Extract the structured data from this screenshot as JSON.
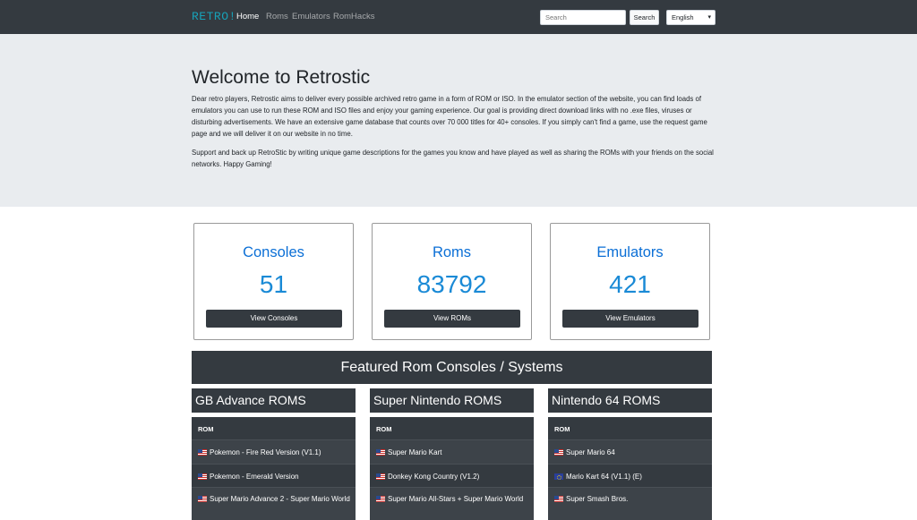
{
  "nav": {
    "brand": "RETRO!",
    "links": [
      "Home",
      "Roms",
      "Emulators",
      "RomHacks"
    ],
    "search_placeholder": "Search",
    "search_button": "Search",
    "language": "English"
  },
  "jumbotron": {
    "title": "Welcome to Retrostic",
    "paragraph1": "Dear retro players, Retrostic aims to deliver every possible archived retro game in a form of ROM or ISO. In the emulator section of the website, you can find loads of emulators you can use to run these ROM and ISO files and enjoy your gaming experience. Our goal is providing direct download links with no .exe files, viruses or disturbing advertisements. We have an extensive game database that counts over 70 000 titles for 40+ consoles. If you simply can't find a game, use the request game page and we will deliver it on our website in no time.",
    "paragraph2": "Support and back up RetroStic by writing unique game descriptions for the games you know and have played as well as sharing the ROMs with your friends on the social networks. Happy Gaming!"
  },
  "stats": [
    {
      "title": "Consoles",
      "count": "51",
      "button": "View Consoles"
    },
    {
      "title": "Roms",
      "count": "83792",
      "button": "View ROMs"
    },
    {
      "title": "Emulators",
      "count": "421",
      "button": "View Emulators"
    }
  ],
  "featured_title": "Featured Rom Consoles / Systems",
  "columns": [
    {
      "heading": "GB Advance ROMS",
      "table_header": "ROM",
      "rows": [
        {
          "flag": "us",
          "name": "Pokemon - Fire Red Version (V1.1)"
        },
        {
          "flag": "us",
          "name": "Pokemon - Emerald Version"
        },
        {
          "flag": "us",
          "name": "Super Mario Advance 2 - Super Mario World"
        }
      ]
    },
    {
      "heading": "Super Nintendo ROMS",
      "table_header": "ROM",
      "rows": [
        {
          "flag": "us",
          "name": "Super Mario Kart"
        },
        {
          "flag": "us",
          "name": "Donkey Kong Country (V1.2)"
        },
        {
          "flag": "us",
          "name": "Super Mario All-Stars + Super Mario World"
        }
      ]
    },
    {
      "heading": "Nintendo 64 ROMS",
      "table_header": "ROM",
      "rows": [
        {
          "flag": "us",
          "name": "Super Mario 64"
        },
        {
          "flag": "eu",
          "name": "Mario Kart 64 (V1.1) (E)"
        },
        {
          "flag": "us",
          "name": "Super Smash Bros."
        }
      ]
    }
  ],
  "colors": {
    "navbar": "#343a40",
    "jumbotron": "#e9ecef",
    "accent": "#0b6fd6",
    "brand": "#17a2b8"
  }
}
